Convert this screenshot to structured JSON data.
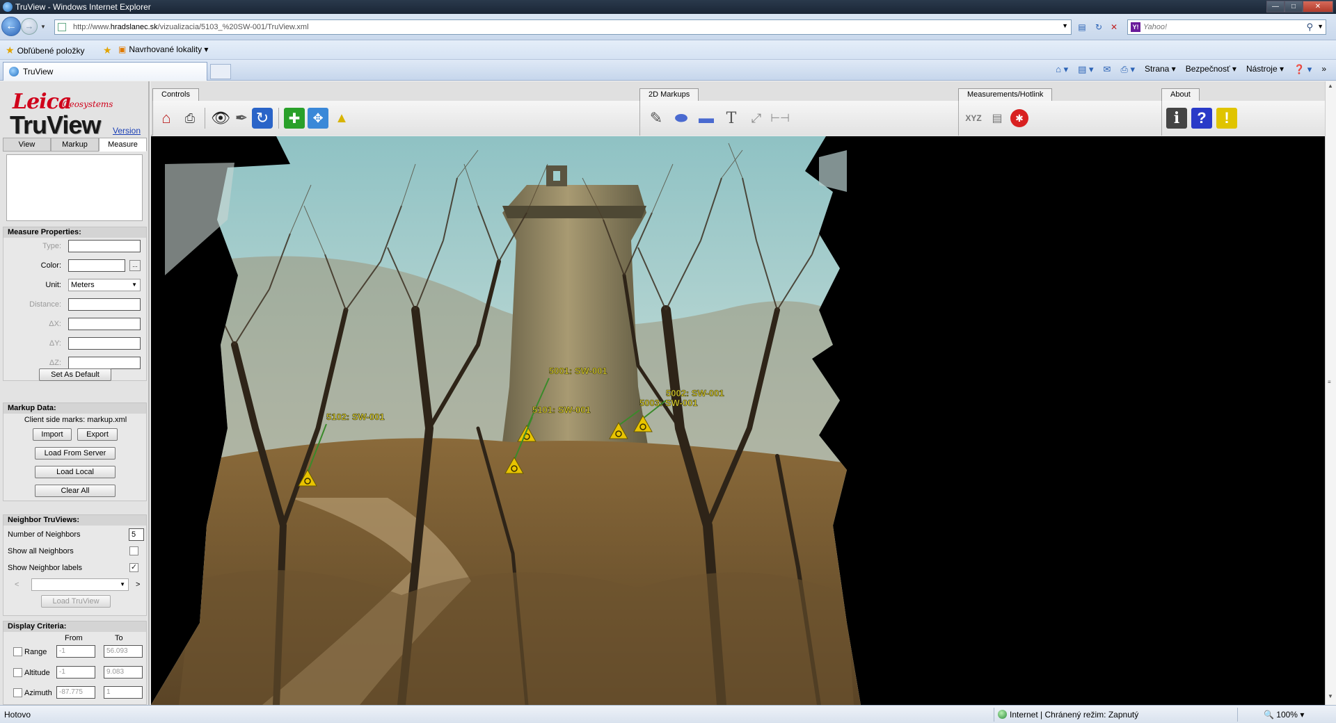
{
  "window": {
    "title": "TruView - Windows Internet Explorer"
  },
  "address": {
    "url_prefix": "http://www.",
    "url_domain": "hradslanec.sk",
    "url_rest": "/vizualizacia/5103_%20SW-001/TruView.xml"
  },
  "search": {
    "placeholder": "Yahoo!"
  },
  "favorites": {
    "label": "Obľúbené položky",
    "suggested": "Navrhované lokality"
  },
  "tab": {
    "label": "TruView"
  },
  "commands": {
    "page": "Strana",
    "safety": "Bezpečnosť",
    "tools": "Nástroje"
  },
  "logo": {
    "brand": "Leica",
    "sub": "Geosystems",
    "product": "TruView",
    "version_link": "Version"
  },
  "panel_tabs": [
    "View",
    "Markup",
    "Measure"
  ],
  "measure_props": {
    "title": "Measure Properties:",
    "type_label": "Type:",
    "color_label": "Color:",
    "color_btn": "...",
    "unit_label": "Unit:",
    "unit_value": "Meters",
    "distance_label": "Distance:",
    "dx_label": "ΔX:",
    "dy_label": "ΔY:",
    "dz_label": "ΔZ:",
    "default_btn": "Set As Default"
  },
  "markup_data": {
    "title": "Markup Data:",
    "client_text": "Client side marks: markup.xml",
    "import_btn": "Import",
    "export_btn": "Export",
    "load_server_btn": "Load From Server",
    "load_local_btn": "Load Local",
    "clear_btn": "Clear All"
  },
  "neighbors": {
    "title": "Neighbor TruViews:",
    "count_label": "Number of Neighbors",
    "count_value": "5",
    "show_all_label": "Show all Neighbors",
    "show_all_checked": false,
    "show_labels_label": "Show Neighbor labels",
    "show_labels_checked": true,
    "prev": "<",
    "next": ">",
    "load_btn": "Load TruView"
  },
  "display_criteria": {
    "title": "Display Criteria:",
    "from_label": "From",
    "to_label": "To",
    "rows": [
      {
        "label": "Range",
        "from": "-1",
        "to": "56.093"
      },
      {
        "label": "Altitude",
        "from": "-1",
        "to": "9.083"
      },
      {
        "label": "Azimuth",
        "from": "-87.775",
        "to": "1"
      }
    ]
  },
  "toolbar": {
    "controls_tab": "Controls",
    "markups_tab": "2D Markups",
    "measurements_tab": "Measurements/Hotlink",
    "about_tab": "About",
    "xyz_label": "XYZ"
  },
  "markers": [
    {
      "label": "5001: SW-001"
    },
    {
      "label": "5002: SW-001"
    },
    {
      "label": "5003: SW-001"
    },
    {
      "label": "5101: SW-001"
    },
    {
      "label": "5102: SW-001"
    }
  ],
  "status": {
    "left": "Hotovo",
    "zone": "Internet | Chránený režim: Zapnutý",
    "zoom": "100%"
  },
  "colors": {
    "leica_red": "#d0021b",
    "marker_yellow": "#f2e23a",
    "link_blue": "#1a3fb5"
  }
}
